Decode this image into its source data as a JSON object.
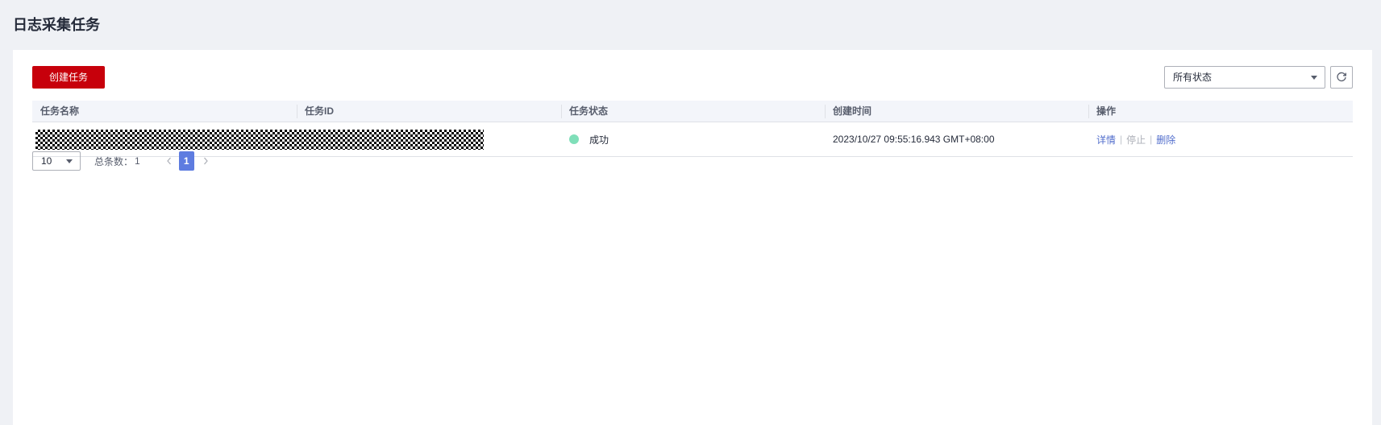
{
  "page": {
    "title": "日志采集任务"
  },
  "toolbar": {
    "create_label": "创建任务",
    "status_filter": "所有状态"
  },
  "table": {
    "columns": [
      "任务名称",
      "任务ID",
      "任务状态",
      "创建时间",
      "操作"
    ],
    "rows": [
      {
        "status": "成功",
        "created": "2023/10/27 09:55:16.943 GMT+08:00",
        "actions": {
          "detail": "详情",
          "stop": "停止",
          "delete": "删除"
        }
      }
    ]
  },
  "pagination": {
    "page_size": "10",
    "total_label": "总条数：",
    "total_count": "1",
    "current_page": "1"
  },
  "colors": {
    "brand": "#c7000b",
    "link": "#526ecc",
    "success": "#7fdfb9",
    "page_active": "#5e7ce0"
  },
  "icons": {
    "refresh": "refresh-icon",
    "dropdown": "chevron-down-icon",
    "prev": "chevron-left-icon",
    "next": "chevron-right-icon"
  }
}
